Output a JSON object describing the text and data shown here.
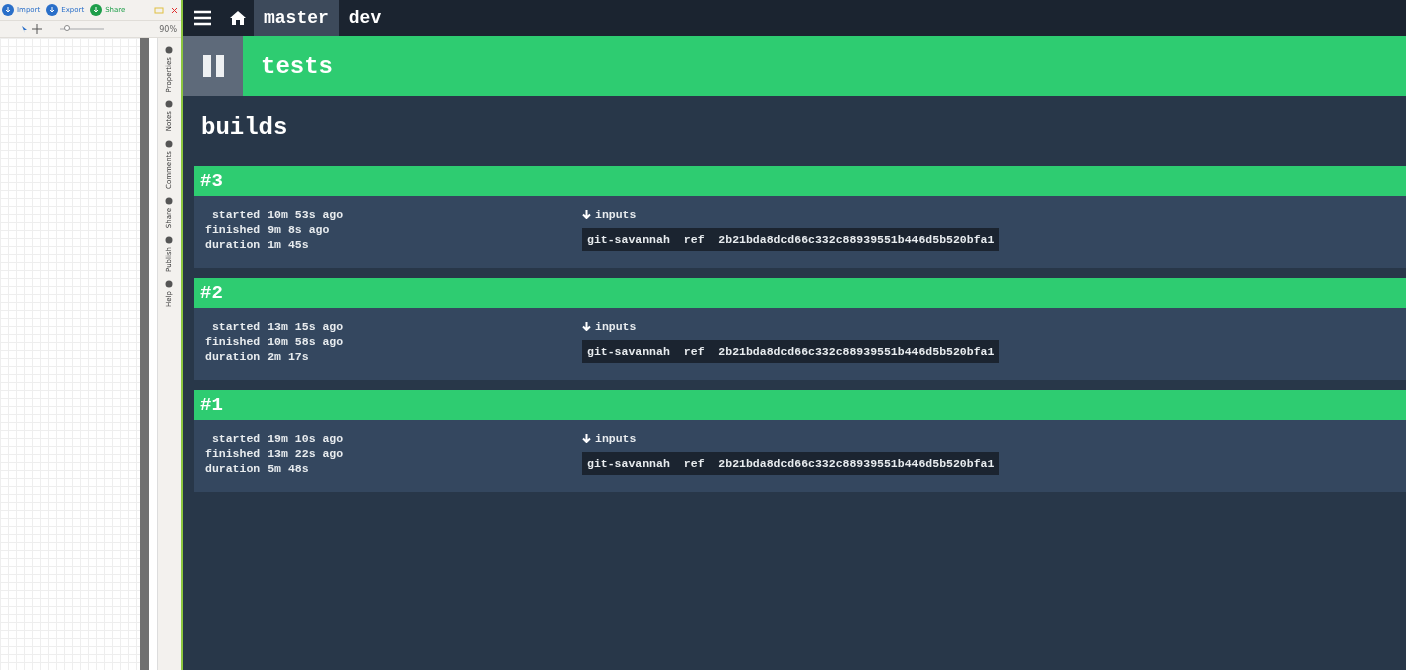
{
  "editor_panel": {
    "toolbar_buttons": [
      {
        "label": "Import",
        "color": "#2a6fc9"
      },
      {
        "label": "Export",
        "color": "#2a6fc9"
      },
      {
        "label": "Share",
        "color": "#1e9e4a"
      }
    ],
    "zoom": {
      "level": 0.15,
      "reading": "90%"
    },
    "side_tabs": [
      "Properties",
      "Notes",
      "Comments",
      "Share",
      "Publish",
      "Help"
    ]
  },
  "nav": {
    "branches": [
      {
        "label": "master",
        "selected": true
      },
      {
        "label": "dev",
        "selected": false
      }
    ]
  },
  "pipeline": {
    "name": "tests"
  },
  "section_title": "builds",
  "builds": [
    {
      "number": "#3",
      "details": [
        {
          "label": "started",
          "value": "10m 53s ago"
        },
        {
          "label": "finished",
          "value": "9m 8s ago"
        },
        {
          "label": "duration",
          "value": "1m 45s"
        }
      ],
      "inputs_label": "inputs",
      "inputs": [
        {
          "name": "git-savannah",
          "key": "ref",
          "value": "2b21bda8dcd66c332c88939551b446d5b520bfa1"
        }
      ]
    },
    {
      "number": "#2",
      "details": [
        {
          "label": "started",
          "value": "13m 15s ago"
        },
        {
          "label": "finished",
          "value": "10m 58s ago"
        },
        {
          "label": "duration",
          "value": "2m 17s"
        }
      ],
      "inputs_label": "inputs",
      "inputs": [
        {
          "name": "git-savannah",
          "key": "ref",
          "value": "2b21bda8dcd66c332c88939551b446d5b520bfa1"
        }
      ]
    },
    {
      "number": "#1",
      "details": [
        {
          "label": "started",
          "value": "19m 10s ago"
        },
        {
          "label": "finished",
          "value": "13m 22s ago"
        },
        {
          "label": "duration",
          "value": "5m 48s"
        }
      ],
      "inputs_label": "inputs",
      "inputs": [
        {
          "name": "git-savannah",
          "key": "ref",
          "value": "2b21bda8dcd66c332c88939551b446d5b520bfa1"
        }
      ]
    }
  ]
}
